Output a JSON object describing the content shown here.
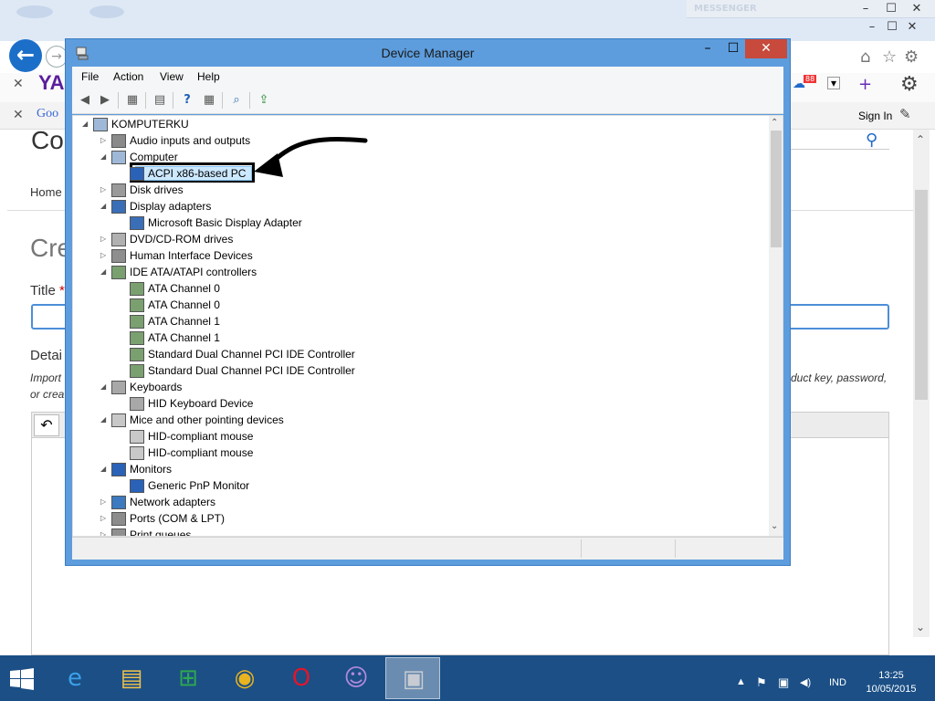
{
  "browser": {
    "messenger_label": "MESSENGER",
    "logo_yahoo": "YA",
    "logo_google": "Goo",
    "sign_in": "Sign In",
    "page_heading": "Co",
    "home_link": "Home",
    "create_heading": "Cre",
    "title_label": "Title",
    "title_required": "*",
    "details_label": "Detai",
    "hint_left_1": "Import",
    "hint_left_2": "or crea",
    "hint_right": "duct key, password,",
    "badge": "88"
  },
  "device_manager": {
    "title": "Device Manager",
    "window_buttons": {
      "minimize": "–",
      "maximize": "☐",
      "close": "✕"
    },
    "menu": [
      "File",
      "Action",
      "View",
      "Help"
    ],
    "tree": [
      {
        "label": "KOMPUTERKU",
        "level": 0,
        "expander": "◢",
        "icon": "computer-icon"
      },
      {
        "label": "Audio inputs and outputs",
        "level": 1,
        "expander": "▷",
        "icon": "speaker-icon"
      },
      {
        "label": "Computer",
        "level": 1,
        "expander": "◢",
        "icon": "computer-icon"
      },
      {
        "label": "ACPI x86-based PC",
        "level": 2,
        "expander": "",
        "icon": "monitor-icon",
        "selected": true
      },
      {
        "label": "Disk drives",
        "level": 1,
        "expander": "▷",
        "icon": "drive-icon"
      },
      {
        "label": "Display adapters",
        "level": 1,
        "expander": "◢",
        "icon": "display-adapter-icon"
      },
      {
        "label": "Microsoft Basic Display Adapter",
        "level": 2,
        "expander": "",
        "icon": "display-adapter-icon"
      },
      {
        "label": "DVD/CD-ROM drives",
        "level": 1,
        "expander": "▷",
        "icon": "disc-icon"
      },
      {
        "label": "Human Interface Devices",
        "level": 1,
        "expander": "▷",
        "icon": "hid-icon"
      },
      {
        "label": "IDE ATA/ATAPI controllers",
        "level": 1,
        "expander": "◢",
        "icon": "controller-icon"
      },
      {
        "label": "ATA Channel 0",
        "level": 2,
        "expander": "",
        "icon": "controller-icon"
      },
      {
        "label": "ATA Channel 0",
        "level": 2,
        "expander": "",
        "icon": "controller-icon"
      },
      {
        "label": "ATA Channel 1",
        "level": 2,
        "expander": "",
        "icon": "controller-icon"
      },
      {
        "label": "ATA Channel 1",
        "level": 2,
        "expander": "",
        "icon": "controller-icon"
      },
      {
        "label": "Standard Dual Channel PCI IDE Controller",
        "level": 2,
        "expander": "",
        "icon": "controller-icon"
      },
      {
        "label": "Standard Dual Channel PCI IDE Controller",
        "level": 2,
        "expander": "",
        "icon": "controller-icon"
      },
      {
        "label": "Keyboards",
        "level": 1,
        "expander": "◢",
        "icon": "keyboard-icon"
      },
      {
        "label": "HID Keyboard Device",
        "level": 2,
        "expander": "",
        "icon": "keyboard-icon"
      },
      {
        "label": "Mice and other pointing devices",
        "level": 1,
        "expander": "◢",
        "icon": "mouse-icon"
      },
      {
        "label": "HID-compliant mouse",
        "level": 2,
        "expander": "",
        "icon": "mouse-icon"
      },
      {
        "label": "HID-compliant mouse",
        "level": 2,
        "expander": "",
        "icon": "mouse-icon"
      },
      {
        "label": "Monitors",
        "level": 1,
        "expander": "◢",
        "icon": "monitor-icon"
      },
      {
        "label": "Generic PnP Monitor",
        "level": 2,
        "expander": "",
        "icon": "monitor-icon"
      },
      {
        "label": "Network adapters",
        "level": 1,
        "expander": "▷",
        "icon": "network-icon"
      },
      {
        "label": "Ports (COM & LPT)",
        "level": 1,
        "expander": "▷",
        "icon": "port-icon"
      },
      {
        "label": "Print queues",
        "level": 1,
        "expander": "▷",
        "icon": "printer-icon"
      }
    ]
  },
  "taskbar": {
    "apps": [
      {
        "name": "internet-explorer",
        "glyph": "e",
        "color": "#3aa0e8"
      },
      {
        "name": "file-explorer",
        "glyph": "▤",
        "color": "#f3c34a"
      },
      {
        "name": "windows-store",
        "glyph": "⊞",
        "color": "#2fa84f"
      },
      {
        "name": "chrome",
        "glyph": "◉",
        "color": "#e8b41f"
      },
      {
        "name": "opera",
        "glyph": "O",
        "color": "#e0162b"
      },
      {
        "name": "yahoo-messenger",
        "glyph": "☺",
        "color": "#b48ae0"
      },
      {
        "name": "device-manager",
        "glyph": "▣",
        "color": "#c8ccd2",
        "active": true
      }
    ],
    "tray_icons": [
      "▲",
      "⚑",
      "▣",
      "◀)"
    ],
    "language": "IND",
    "time": "13:25",
    "date": "10/05/2015"
  },
  "colors": {
    "window_frame": "#5d9ddd",
    "selection": "#cce8ff",
    "taskbar": "#1b4f86",
    "close_button": "#c74a3c"
  }
}
